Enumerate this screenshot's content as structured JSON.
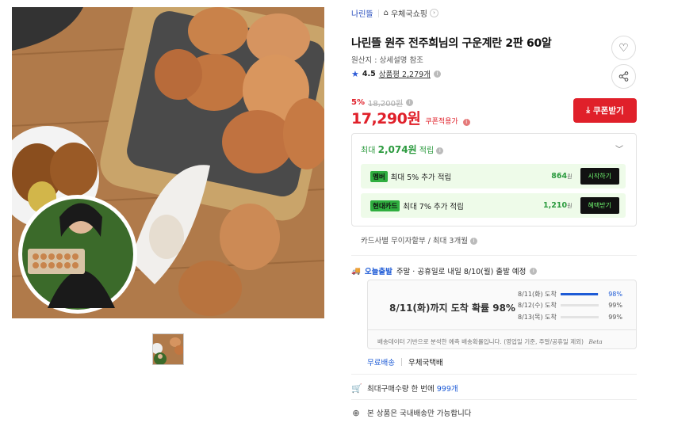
{
  "breadcrumb": {
    "brand": "나린뜰",
    "store": "우체국쇼핑"
  },
  "product": {
    "title": "나린뜰 원주 전주희님의 구운계란 2판 60알",
    "origin": "원산지 : 상세설명 참조",
    "rating": "4.5",
    "reviews": "상품평 2,279개"
  },
  "price": {
    "discount": "5%",
    "original": "18,200원",
    "sale": "17,290원",
    "coupon_note": "쿠폰적용가",
    "coupon_button": "쿠폰받기"
  },
  "reward": {
    "head_prefix": "최대",
    "head_amount": "2,074원",
    "head_suffix": "적립",
    "rows": [
      {
        "tag": "멤버",
        "text": "최대 5% 추가 적립",
        "amount": "864",
        "unit": "원",
        "button": "시작하기"
      },
      {
        "tag": "현대카드",
        "text": "최대 7% 추가 적립",
        "amount": "1,210",
        "unit": "원",
        "button": "혜택받기"
      }
    ]
  },
  "installment": "카드사별 무이자할부 / 최대 3개월",
  "shipping": {
    "today_label": "오늘출발",
    "head": "주말 · 공휴일로 내일 8/10(월) 출발 예정",
    "main": "8/11(화)까지 도착 확률 98%",
    "lines": [
      {
        "date": "8/11(화) 도착",
        "pct": "98%",
        "ratio": 0.98
      },
      {
        "date": "8/12(수) 도착",
        "pct": "99%",
        "ratio": 0
      },
      {
        "date": "8/13(목) 도착",
        "pct": "99%",
        "ratio": 0
      }
    ],
    "footnote": "배송데이터 기반으로 분석한 예측 배송확률입니다. (영업일 기준, 주말/공휴일 제외)",
    "beta": "Beta"
  },
  "delivery": {
    "fee": "무료배송",
    "carrier": "우체국택배"
  },
  "max_qty": {
    "prefix": "최대구매수량 한 번에",
    "value": "999개"
  },
  "domestic": "본 상품은 국내배송만 가능합니다"
}
